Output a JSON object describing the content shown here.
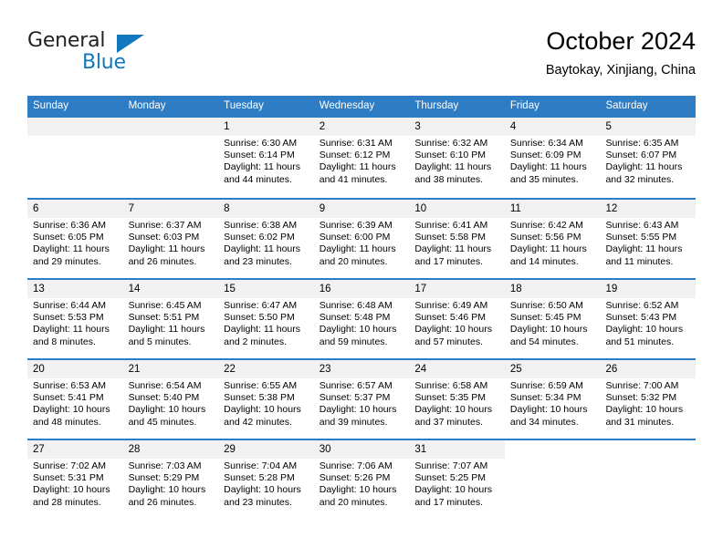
{
  "brand": {
    "line1": "General",
    "line2": "Blue",
    "logo_icon": "triangle-logo-icon",
    "accent_color": "#1278be"
  },
  "header": {
    "title": "October 2024",
    "subtitle": "Baytokay, Xinjiang, China"
  },
  "theme": {
    "header_bar_color": "#2e7cc4",
    "date_band_color": "#f1f1f1",
    "row_rule_color": "#2e7cc4"
  },
  "calendar": {
    "weekday_headers": [
      "Sunday",
      "Monday",
      "Tuesday",
      "Wednesday",
      "Thursday",
      "Friday",
      "Saturday"
    ],
    "weeks": [
      [
        {
          "day": "",
          "lines": []
        },
        {
          "day": "",
          "lines": []
        },
        {
          "day": "1",
          "lines": [
            "Sunrise: 6:30 AM",
            "Sunset: 6:14 PM",
            "Daylight: 11 hours",
            "and 44 minutes."
          ]
        },
        {
          "day": "2",
          "lines": [
            "Sunrise: 6:31 AM",
            "Sunset: 6:12 PM",
            "Daylight: 11 hours",
            "and 41 minutes."
          ]
        },
        {
          "day": "3",
          "lines": [
            "Sunrise: 6:32 AM",
            "Sunset: 6:10 PM",
            "Daylight: 11 hours",
            "and 38 minutes."
          ]
        },
        {
          "day": "4",
          "lines": [
            "Sunrise: 6:34 AM",
            "Sunset: 6:09 PM",
            "Daylight: 11 hours",
            "and 35 minutes."
          ]
        },
        {
          "day": "5",
          "lines": [
            "Sunrise: 6:35 AM",
            "Sunset: 6:07 PM",
            "Daylight: 11 hours",
            "and 32 minutes."
          ]
        }
      ],
      [
        {
          "day": "6",
          "lines": [
            "Sunrise: 6:36 AM",
            "Sunset: 6:05 PM",
            "Daylight: 11 hours",
            "and 29 minutes."
          ]
        },
        {
          "day": "7",
          "lines": [
            "Sunrise: 6:37 AM",
            "Sunset: 6:03 PM",
            "Daylight: 11 hours",
            "and 26 minutes."
          ]
        },
        {
          "day": "8",
          "lines": [
            "Sunrise: 6:38 AM",
            "Sunset: 6:02 PM",
            "Daylight: 11 hours",
            "and 23 minutes."
          ]
        },
        {
          "day": "9",
          "lines": [
            "Sunrise: 6:39 AM",
            "Sunset: 6:00 PM",
            "Daylight: 11 hours",
            "and 20 minutes."
          ]
        },
        {
          "day": "10",
          "lines": [
            "Sunrise: 6:41 AM",
            "Sunset: 5:58 PM",
            "Daylight: 11 hours",
            "and 17 minutes."
          ]
        },
        {
          "day": "11",
          "lines": [
            "Sunrise: 6:42 AM",
            "Sunset: 5:56 PM",
            "Daylight: 11 hours",
            "and 14 minutes."
          ]
        },
        {
          "day": "12",
          "lines": [
            "Sunrise: 6:43 AM",
            "Sunset: 5:55 PM",
            "Daylight: 11 hours",
            "and 11 minutes."
          ]
        }
      ],
      [
        {
          "day": "13",
          "lines": [
            "Sunrise: 6:44 AM",
            "Sunset: 5:53 PM",
            "Daylight: 11 hours",
            "and 8 minutes."
          ]
        },
        {
          "day": "14",
          "lines": [
            "Sunrise: 6:45 AM",
            "Sunset: 5:51 PM",
            "Daylight: 11 hours",
            "and 5 minutes."
          ]
        },
        {
          "day": "15",
          "lines": [
            "Sunrise: 6:47 AM",
            "Sunset: 5:50 PM",
            "Daylight: 11 hours",
            "and 2 minutes."
          ]
        },
        {
          "day": "16",
          "lines": [
            "Sunrise: 6:48 AM",
            "Sunset: 5:48 PM",
            "Daylight: 10 hours",
            "and 59 minutes."
          ]
        },
        {
          "day": "17",
          "lines": [
            "Sunrise: 6:49 AM",
            "Sunset: 5:46 PM",
            "Daylight: 10 hours",
            "and 57 minutes."
          ]
        },
        {
          "day": "18",
          "lines": [
            "Sunrise: 6:50 AM",
            "Sunset: 5:45 PM",
            "Daylight: 10 hours",
            "and 54 minutes."
          ]
        },
        {
          "day": "19",
          "lines": [
            "Sunrise: 6:52 AM",
            "Sunset: 5:43 PM",
            "Daylight: 10 hours",
            "and 51 minutes."
          ]
        }
      ],
      [
        {
          "day": "20",
          "lines": [
            "Sunrise: 6:53 AM",
            "Sunset: 5:41 PM",
            "Daylight: 10 hours",
            "and 48 minutes."
          ]
        },
        {
          "day": "21",
          "lines": [
            "Sunrise: 6:54 AM",
            "Sunset: 5:40 PM",
            "Daylight: 10 hours",
            "and 45 minutes."
          ]
        },
        {
          "day": "22",
          "lines": [
            "Sunrise: 6:55 AM",
            "Sunset: 5:38 PM",
            "Daylight: 10 hours",
            "and 42 minutes."
          ]
        },
        {
          "day": "23",
          "lines": [
            "Sunrise: 6:57 AM",
            "Sunset: 5:37 PM",
            "Daylight: 10 hours",
            "and 39 minutes."
          ]
        },
        {
          "day": "24",
          "lines": [
            "Sunrise: 6:58 AM",
            "Sunset: 5:35 PM",
            "Daylight: 10 hours",
            "and 37 minutes."
          ]
        },
        {
          "day": "25",
          "lines": [
            "Sunrise: 6:59 AM",
            "Sunset: 5:34 PM",
            "Daylight: 10 hours",
            "and 34 minutes."
          ]
        },
        {
          "day": "26",
          "lines": [
            "Sunrise: 7:00 AM",
            "Sunset: 5:32 PM",
            "Daylight: 10 hours",
            "and 31 minutes."
          ]
        }
      ],
      [
        {
          "day": "27",
          "lines": [
            "Sunrise: 7:02 AM",
            "Sunset: 5:31 PM",
            "Daylight: 10 hours",
            "and 28 minutes."
          ]
        },
        {
          "day": "28",
          "lines": [
            "Sunrise: 7:03 AM",
            "Sunset: 5:29 PM",
            "Daylight: 10 hours",
            "and 26 minutes."
          ]
        },
        {
          "day": "29",
          "lines": [
            "Sunrise: 7:04 AM",
            "Sunset: 5:28 PM",
            "Daylight: 10 hours",
            "and 23 minutes."
          ]
        },
        {
          "day": "30",
          "lines": [
            "Sunrise: 7:06 AM",
            "Sunset: 5:26 PM",
            "Daylight: 10 hours",
            "and 20 minutes."
          ]
        },
        {
          "day": "31",
          "lines": [
            "Sunrise: 7:07 AM",
            "Sunset: 5:25 PM",
            "Daylight: 10 hours",
            "and 17 minutes."
          ]
        },
        {
          "day": "",
          "lines": []
        },
        {
          "day": "",
          "lines": []
        }
      ]
    ]
  }
}
